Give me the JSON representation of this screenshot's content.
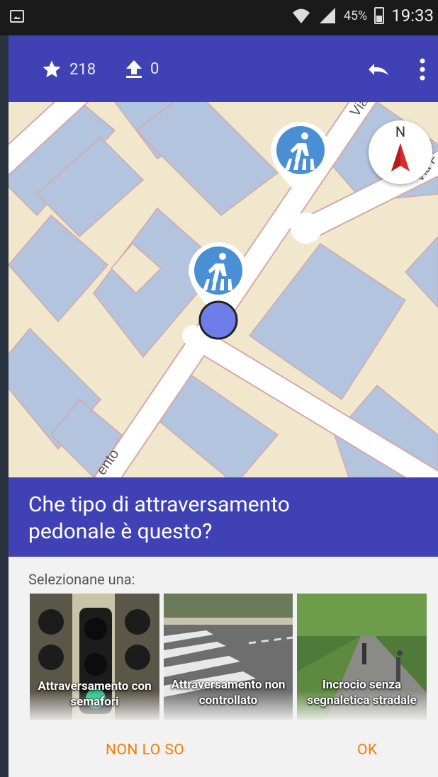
{
  "status_bar": {
    "battery_percent": "45%",
    "time": "19:33"
  },
  "toolbar": {
    "stars_count": "218",
    "uploads_count": "0"
  },
  "map": {
    "compass_label": "N",
    "street_labels": [
      "Via",
      "Via F",
      "ento"
    ],
    "markers": [
      "pedestrian-crossing-icon",
      "pedestrian-crossing-icon"
    ]
  },
  "question": {
    "title": "Che tipo di attraversamento pedonale è questo?"
  },
  "answers": {
    "hint": "Selezionane una:",
    "options": [
      {
        "label": "Attraversamento con semafori"
      },
      {
        "label": "Attraversamento non controllato"
      },
      {
        "label": "Incrocio senza segnaletica stradale"
      }
    ]
  },
  "actions": {
    "dont_know": "NON LO SO",
    "ok": "OK"
  },
  "colors": {
    "primary": "#3f41b5",
    "accent": "#f57c00",
    "map_bg": "#f1e7cd",
    "building": "#b3c4df"
  }
}
